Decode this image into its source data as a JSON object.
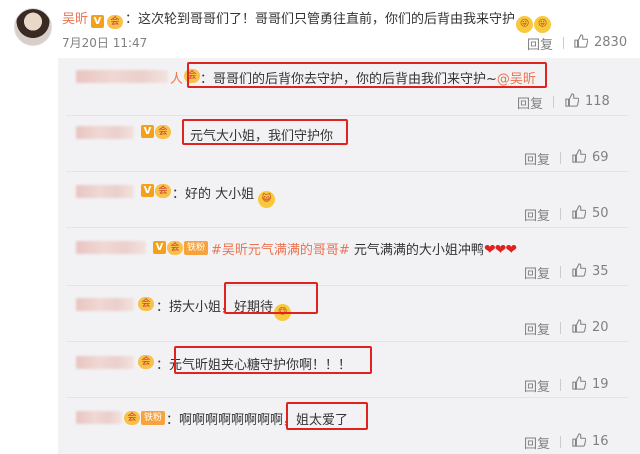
{
  "post": {
    "author": "吴昕",
    "text": "：这次轮到哥哥们了！哥哥们只管勇往直前，你们的后背由我来守护",
    "emoji_count": 2,
    "time": "7月20日 11:47",
    "reply_label": "回复",
    "likes": "2830"
  },
  "comments": [
    {
      "name_suffix": "人",
      "text": "：哥哥们的后背你去守护，你的后背由我们来守护~",
      "mention": "@吴昕",
      "reply_label": "回复",
      "likes": "118"
    },
    {
      "text": "元气大小姐，我们守护你",
      "reply_label": "回复",
      "likes": "69"
    },
    {
      "text": "：好的  大小姐",
      "reply_label": "回复",
      "likes": "50"
    },
    {
      "badge": "铁粉",
      "topic": "#吴昕元气满满的哥哥#",
      "text": " 元气满满的大小姐冲鸭",
      "hearts": "❤❤❤",
      "reply_label": "回复",
      "likes": "35"
    },
    {
      "text_a": "：捞大小姐，",
      "text_b": "好期待",
      "reply_label": "回复",
      "likes": "20"
    },
    {
      "text": "：元气昕姐夹心糖守护你啊！！！",
      "reply_label": "回复",
      "likes": "19"
    },
    {
      "badge": "铁粉",
      "text_a": "：啊啊啊啊啊啊啊啊，",
      "text_b": "姐太爱了",
      "reply_label": "回复",
      "likes": "16"
    }
  ],
  "icons": {
    "verified": "V",
    "member": "会",
    "emoji": "emoji-face-icon",
    "like": "thumb-up-icon"
  },
  "colors": {
    "username": "#eb7350",
    "highlight_box": "#e0231e",
    "panel_bg": "#f2f2f5"
  }
}
